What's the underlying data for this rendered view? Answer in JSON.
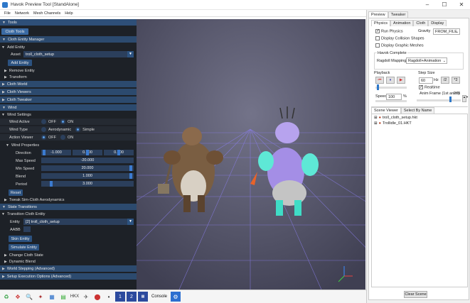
{
  "window": {
    "title": "Havok Preview Tool [StandAlone]",
    "min": "–",
    "max": "☐",
    "close": "✕"
  },
  "menu": [
    "File",
    "Network",
    "Mesh Channels",
    "Help"
  ],
  "left": {
    "tools": "Tools",
    "cloth_tools": "Cloth Tools",
    "cem": "Cloth Entity Manager",
    "add_entity": "Add Entity",
    "asset_label": "Asset",
    "asset_value": "troll_cloth_setup",
    "add_entity_btn": "Add Entity",
    "remove_entity": "Remove Entity",
    "transform": "Transform",
    "cloth_world": "Cloth World",
    "cloth_viewers": "Cloth Viewers",
    "cloth_tweaker": "Cloth Tweaker",
    "wind": "Wind",
    "wind_settings": "Wind Settings",
    "wind_active": "Wind Active",
    "off": "OFF",
    "on": "ON",
    "wind_type": "Wind Type",
    "aerodynamic": "Aerodynamic",
    "simple": "Simple",
    "action_viewer": "Action Viewer",
    "wind_properties": "Wind Properties",
    "direction": "Direction",
    "dir_x": "-1.000",
    "dir_y": "0.000",
    "dir_z": "0.000",
    "max_speed": "Max Speed",
    "max_speed_val": "-20.000",
    "min_speed": "Min Speed",
    "min_speed_val": "20.000",
    "blend": "Blend",
    "blend_val": "1.000",
    "period": "Period",
    "period_val": "3.000",
    "reset": "Reset",
    "tweak": "Tweak Sim-Cloth Aerodynamics",
    "state_transitions": "State Transitions",
    "transition_cloth_entity": "Transition Cloth Entity",
    "entity_label": "Entity",
    "entity_value": "[2] troll_cloth_setup",
    "aabb": "AABB",
    "skin_entity": "Skin Entity",
    "simulate_entity": "Simulate Entity",
    "change_cloth_state": "Change Cloth State",
    "dynamic_blend": "Dynamic Blend",
    "world_stepping": "World Stepping (Advanced)",
    "setup_exec": "Setup Execution Options (Advanced)"
  },
  "right": {
    "tab_preview": "Preview",
    "tab_tweaker": "Tweaker",
    "sub_physics": "Physics",
    "sub_animation": "Animation",
    "sub_cloth": "Cloth",
    "sub_display": "Display",
    "run_physics": "Run Physics",
    "gravity": "Gravity",
    "gravity_value": "FROM_FILE",
    "display_collision": "Display Collision Shapes",
    "display_graphic": "Display Graphic Meshes",
    "havok_complete": "Havok Complete",
    "ragdoll_mapping": "Ragdoll Mapping:",
    "ragdoll_value": "Ragdoll+Animation",
    "playback": "Playback",
    "step_size": "Step Size",
    "step_value": "60",
    "hz": "Hz",
    "half": "/2",
    "double": "*2",
    "realtime": "Realtime",
    "speed": "Speed",
    "speed_value": "100",
    "percent": "%",
    "anim_frame": "Anim Frame (1st anim):",
    "anim_frame_value": "276",
    "scene_viewer": "Scene Viewer",
    "select_by_name": "Select By Name",
    "tree": [
      "troll_cloth_setup.hkt",
      "Trollidle_01.HKT"
    ],
    "clear_scene": "Clear Scene"
  },
  "toolbar": {
    "console": "Console"
  }
}
